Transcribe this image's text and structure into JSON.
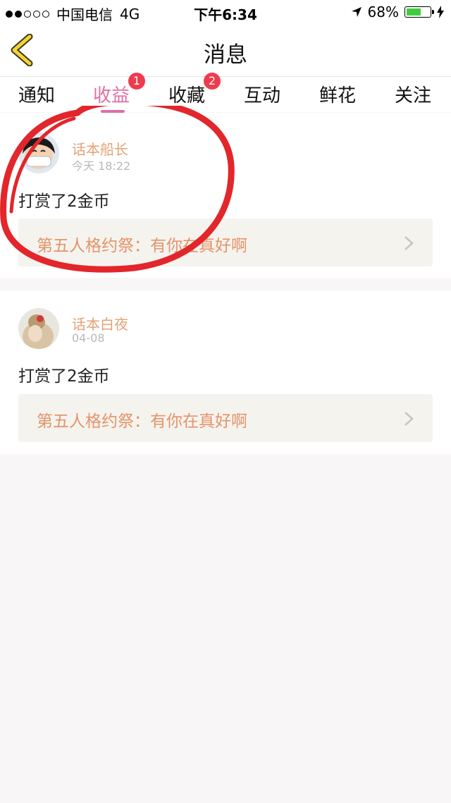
{
  "status": {
    "carrier": "中国电信",
    "network": "4G",
    "time": "下午6:34",
    "battery": "68%",
    "battery_level": 0.68
  },
  "nav": {
    "title": "消息",
    "back_icon": "chevron-left-icon"
  },
  "tabs": [
    {
      "label": "通知",
      "badge": ""
    },
    {
      "label": "收益",
      "badge": "1"
    },
    {
      "label": "收藏",
      "badge": "2"
    },
    {
      "label": "互动",
      "badge": ""
    },
    {
      "label": "鲜花",
      "badge": ""
    },
    {
      "label": "关注",
      "badge": ""
    }
  ],
  "items": [
    {
      "username": "话本船长",
      "date": "今天 18:22",
      "message": "打赏了2金币",
      "link": "第五人格约祭：有你在真好啊"
    },
    {
      "username": "话本白夜",
      "date": "04-08",
      "message": "打赏了2金币",
      "link": "第五人格约祭：有你在真好啊"
    }
  ],
  "colors": {
    "accent": "#e06ea6",
    "username": "#e3a277",
    "badge": "#ef3b4e",
    "annotation": "#e2262b"
  }
}
